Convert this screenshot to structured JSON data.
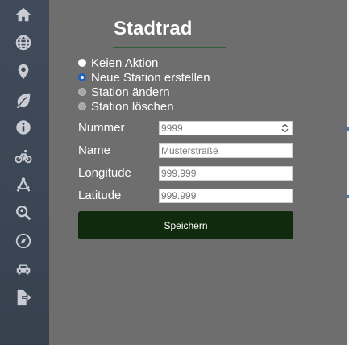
{
  "sidebar": {
    "items": [
      {
        "icon": "home-icon"
      },
      {
        "icon": "globe-icon"
      },
      {
        "icon": "map-pin-icon"
      },
      {
        "icon": "leaf-icon"
      },
      {
        "icon": "info-icon"
      },
      {
        "icon": "bicycle-icon"
      },
      {
        "icon": "compass-drafting-icon"
      },
      {
        "icon": "search-location-icon"
      },
      {
        "icon": "compass-icon"
      },
      {
        "icon": "car-icon"
      },
      {
        "icon": "file-export-icon"
      }
    ]
  },
  "panel": {
    "title": "Stadtrad",
    "actions": [
      {
        "label": "Keien Aktion",
        "state": "unchecked"
      },
      {
        "label": "Neue Station erstellen",
        "state": "checked"
      },
      {
        "label": "Station ändern",
        "state": "disabled"
      },
      {
        "label": "Station löschen",
        "state": "disabled"
      }
    ],
    "fields": {
      "nummer": {
        "label": "Nummer",
        "placeholder": "9999"
      },
      "name": {
        "label": "Name",
        "placeholder": "Musterstraße"
      },
      "longitude": {
        "label": "Longitude",
        "placeholder": "999.999"
      },
      "latitude": {
        "label": "Latitude",
        "placeholder": "999.999"
      }
    },
    "save_label": "Speichern"
  },
  "colors": {
    "sidebar_bg": "#3c4756",
    "panel_bg": "#6e6e6e",
    "accent_green": "#0f2a0d",
    "title_underline": "#2f5f32",
    "radio_checked": "#1f5fbf"
  }
}
